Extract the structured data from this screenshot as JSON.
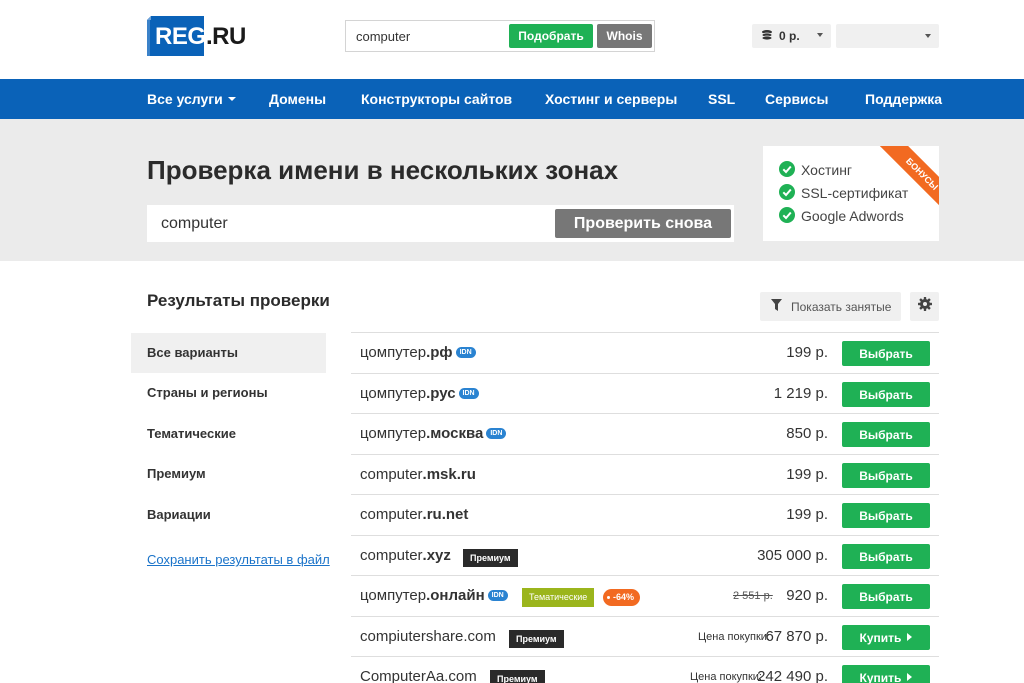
{
  "header": {
    "logo_reg": "REG",
    "logo_ru": ".RU",
    "search_value": "computer",
    "pick_label": "Подобрать",
    "whois_label": "Whois",
    "balance": "0 р."
  },
  "nav": {
    "items": [
      "Все услуги",
      "Домены",
      "Конструкторы сайтов",
      "Хостинг и серверы",
      "SSL",
      "Сервисы",
      "Поддержка"
    ]
  },
  "banner": {
    "title": "Проверка имени в нескольких зонах",
    "input_value": "computer",
    "recheck_label": "Проверить снова",
    "bonus_items": [
      "Хостинг",
      "SSL-сертификат",
      "Google Adwords"
    ],
    "ribbon": "БОНУСЫ"
  },
  "results": {
    "title": "Результаты проверки",
    "show_busy": "Показать занятые",
    "sidebar": [
      "Все варианты",
      "Страны и регионы",
      "Тематические",
      "Премиум",
      "Вариации"
    ],
    "save_link": "Сохранить результаты в файл",
    "rows": [
      {
        "name": "цомпутер",
        "zone": ".рф",
        "idn": "IDN",
        "price": "199 р.",
        "button": "Выбрать"
      },
      {
        "name": "цомпутер",
        "zone": ".рус",
        "idn": "IDN",
        "price": "1 219 р.",
        "button": "Выбрать"
      },
      {
        "name": "цомпутер",
        "zone": ".москва",
        "idn": "IDN",
        "price": "850 р.",
        "button": "Выбрать"
      },
      {
        "name": "computer",
        "zone": ".msk.ru",
        "price": "199 р.",
        "button": "Выбрать"
      },
      {
        "name": "computer",
        "zone": ".ru.net",
        "price": "199 р.",
        "button": "Выбрать"
      },
      {
        "name": "computer",
        "zone": ".xyz",
        "tag": "Премиум",
        "price": "305 000 р.",
        "button": "Выбрать"
      },
      {
        "name": "цомпутер",
        "zone": ".онлайн",
        "idn": "IDN",
        "tag_thematic": "Тематические",
        "discount": "-64%",
        "old_price": "2 551 р.",
        "price": "920 р.",
        "button": "Выбрать"
      },
      {
        "name": "compiutershare.com",
        "tag": "Премиум",
        "price_label": "Цена покупки:",
        "price": "67 870 р.",
        "button": "Купить"
      },
      {
        "name": "ComputerAa.com",
        "tag": "Премиум",
        "price_label": "Цена покупки:",
        "price": "242 490 р.",
        "button": "Купить"
      }
    ]
  },
  "colors": {
    "nav_blue": "#0a62b8",
    "green": "#1fb155",
    "orange": "#f26a21",
    "olive": "#9bb51c",
    "idn_blue": "#2a83d1"
  }
}
